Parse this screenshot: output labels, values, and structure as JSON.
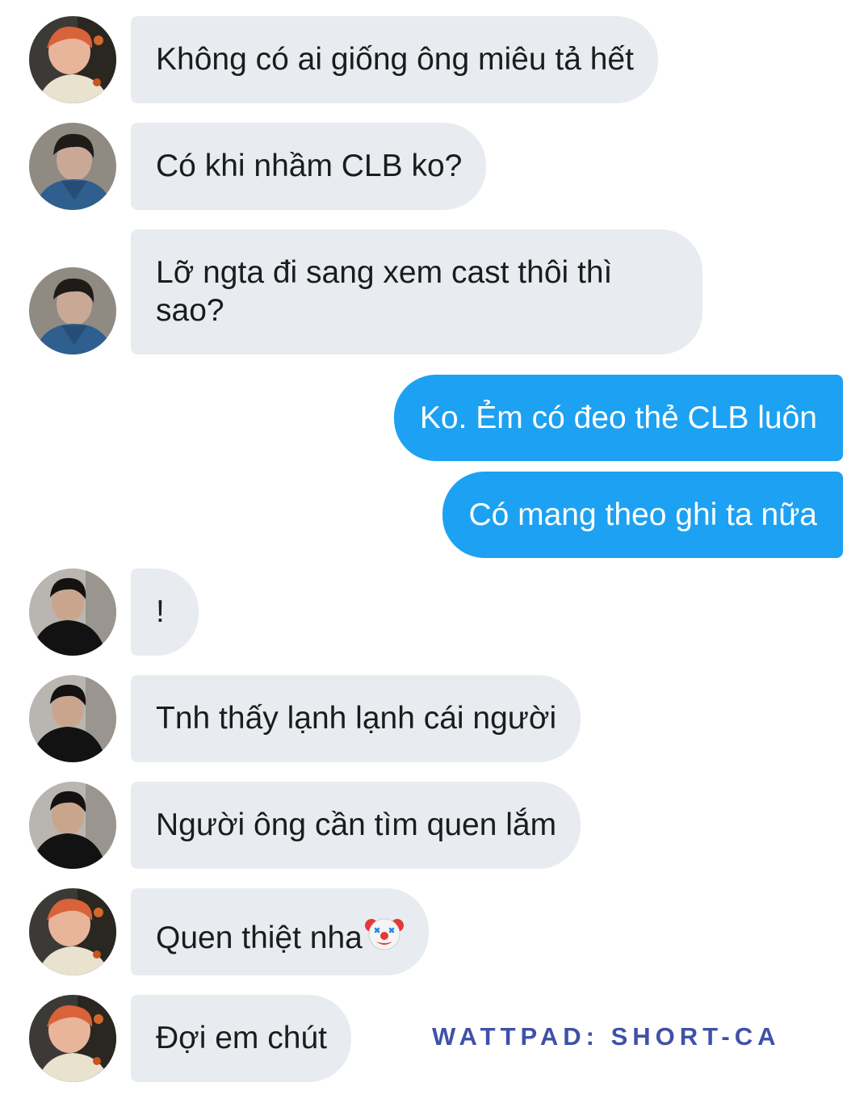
{
  "colors": {
    "incoming_bubble": "#e8ecf1",
    "outgoing_bubble": "#1da1f2",
    "watermark": "#3f51a8"
  },
  "messages": [
    {
      "direction": "incoming",
      "sender": "red-hair-user",
      "text": "Không có ai giống ông miêu tả hết"
    },
    {
      "direction": "incoming",
      "sender": "denim-jacket-user",
      "text": "Có khi nhầm CLB ko?"
    },
    {
      "direction": "incoming",
      "sender": "denim-jacket-user",
      "text": "Lỡ ngta đi sang xem cast thôi thì sao?"
    },
    {
      "direction": "outgoing",
      "text": "Ko. Ẻm có đeo thẻ CLB luôn"
    },
    {
      "direction": "outgoing",
      "text": "Có mang theo ghi ta nữa"
    },
    {
      "direction": "incoming",
      "sender": "black-shirt-user",
      "text": "!"
    },
    {
      "direction": "incoming",
      "sender": "black-shirt-user",
      "text": "Tnh thấy lạnh lạnh cái người"
    },
    {
      "direction": "incoming",
      "sender": "black-shirt-user",
      "text": "Người ông cần tìm quen lắm"
    },
    {
      "direction": "incoming",
      "sender": "red-hair-user",
      "text": "Quen thiệt nha",
      "emoji": "clown-face-icon"
    },
    {
      "direction": "incoming",
      "sender": "red-hair-user",
      "text": "Đợi em chút"
    }
  ],
  "watermark": "WATTPAD: SHORT-CA"
}
